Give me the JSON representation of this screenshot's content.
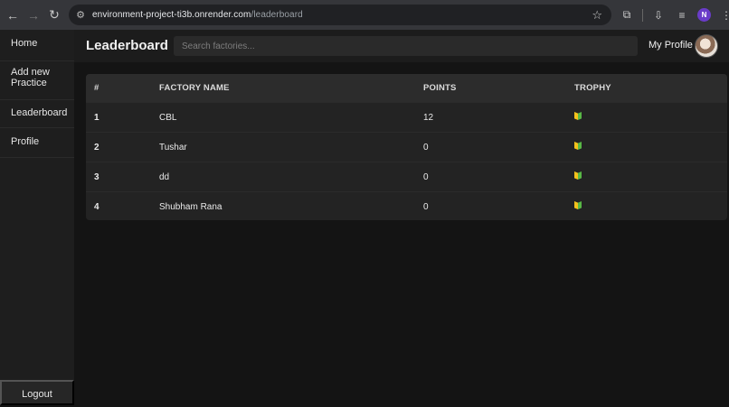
{
  "browser": {
    "url_host": "environment-project-ti3b.onrender.com",
    "url_path": "/leaderboard",
    "profile_initial": "N"
  },
  "sidebar": {
    "items": [
      {
        "label": "Home"
      },
      {
        "label": "Add new Practice"
      },
      {
        "label": "Leaderboard"
      },
      {
        "label": "Profile"
      }
    ],
    "logout_label": "Logout"
  },
  "header": {
    "title": "Leaderboard",
    "search_placeholder": "Search factories...",
    "profile_label": "My Profile"
  },
  "leaderboard": {
    "columns": [
      "#",
      "FACTORY NAME",
      "POINTS",
      "TROPHY"
    ],
    "rows": [
      {
        "rank": "1",
        "name": "CBL",
        "points": "12"
      },
      {
        "rank": "2",
        "name": "Tushar",
        "points": "0"
      },
      {
        "rank": "3",
        "name": "dd",
        "points": "0"
      },
      {
        "rank": "4",
        "name": "Shubham Rana",
        "points": "0"
      }
    ],
    "trophy_icon": "beginner-badge-icon"
  },
  "colors": {
    "background": "#141414",
    "sidebar": "#1e1e1e",
    "table": "#232323",
    "trophy_yellow": "#f4c21c",
    "trophy_green": "#58b846"
  }
}
